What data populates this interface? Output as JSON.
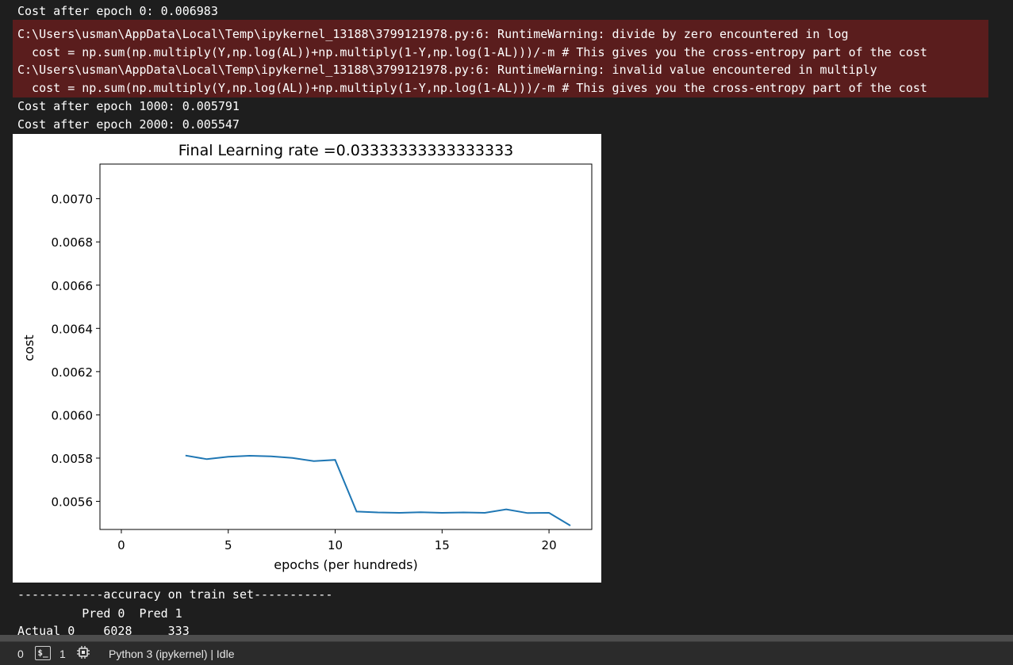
{
  "output": {
    "line1": "Cost after epoch 0: 0.006983",
    "stderr": [
      "C:\\Users\\usman\\AppData\\Local\\Temp\\ipykernel_13188\\3799121978.py:6: RuntimeWarning: divide by zero encountered in log",
      "  cost = np.sum(np.multiply(Y,np.log(AL))+np.multiply(1-Y,np.log(1-AL)))/-m # This gives you the cross-entropy part of the cost",
      "C:\\Users\\usman\\AppData\\Local\\Temp\\ipykernel_13188\\3799121978.py:6: RuntimeWarning: invalid value encountered in multiply",
      "  cost = np.sum(np.multiply(Y,np.log(AL))+np.multiply(1-Y,np.log(1-AL)))/-m # This gives you the cross-entropy part of the cost"
    ],
    "line_1000": "Cost after epoch 1000: 0.005791",
    "line_2000": "Cost after epoch 2000: 0.005547",
    "accuracy_header": "------------accuracy on train set-----------",
    "table_header": "         Pred 0  Pred 1",
    "table_row0": "Actual 0    6028     333"
  },
  "chart_data": {
    "type": "line",
    "title": "Final Learning rate =0.03333333333333333",
    "xlabel": "epochs (per hundreds)",
    "ylabel": "cost",
    "xlim": [
      -1,
      22
    ],
    "ylim": [
      0.00547,
      0.00716
    ],
    "xticks": [
      0,
      5,
      10,
      15,
      20
    ],
    "xtick_labels": [
      "0",
      "5",
      "10",
      "15",
      "20"
    ],
    "yticks": [
      0.0056,
      0.0058,
      0.006,
      0.0062,
      0.0064,
      0.0066,
      0.0068,
      0.007
    ],
    "ytick_labels": [
      "0.0056",
      "0.0058",
      "0.0060",
      "0.0062",
      "0.0064",
      "0.0066",
      "0.0068",
      "0.0070"
    ],
    "grid": false,
    "color": "#1f77b4",
    "series": [
      {
        "x": [
          3,
          4,
          5,
          6,
          7,
          8,
          9,
          10,
          11,
          12,
          13,
          14,
          15,
          16,
          17,
          18,
          19,
          20,
          21
        ],
        "values": [
          0.005812,
          0.005795,
          0.005806,
          0.005811,
          0.005808,
          0.005801,
          0.005786,
          0.005792,
          0.005553,
          0.005549,
          0.005547,
          0.00555,
          0.005547,
          0.005549,
          0.005547,
          0.005563,
          0.005546,
          0.005547,
          0.005488
        ]
      }
    ]
  },
  "statusbar": {
    "count_left": "0",
    "terminal_icon_text": "$_",
    "count_right": "1",
    "kernel_status": "Python 3 (ipykernel) | Idle"
  }
}
